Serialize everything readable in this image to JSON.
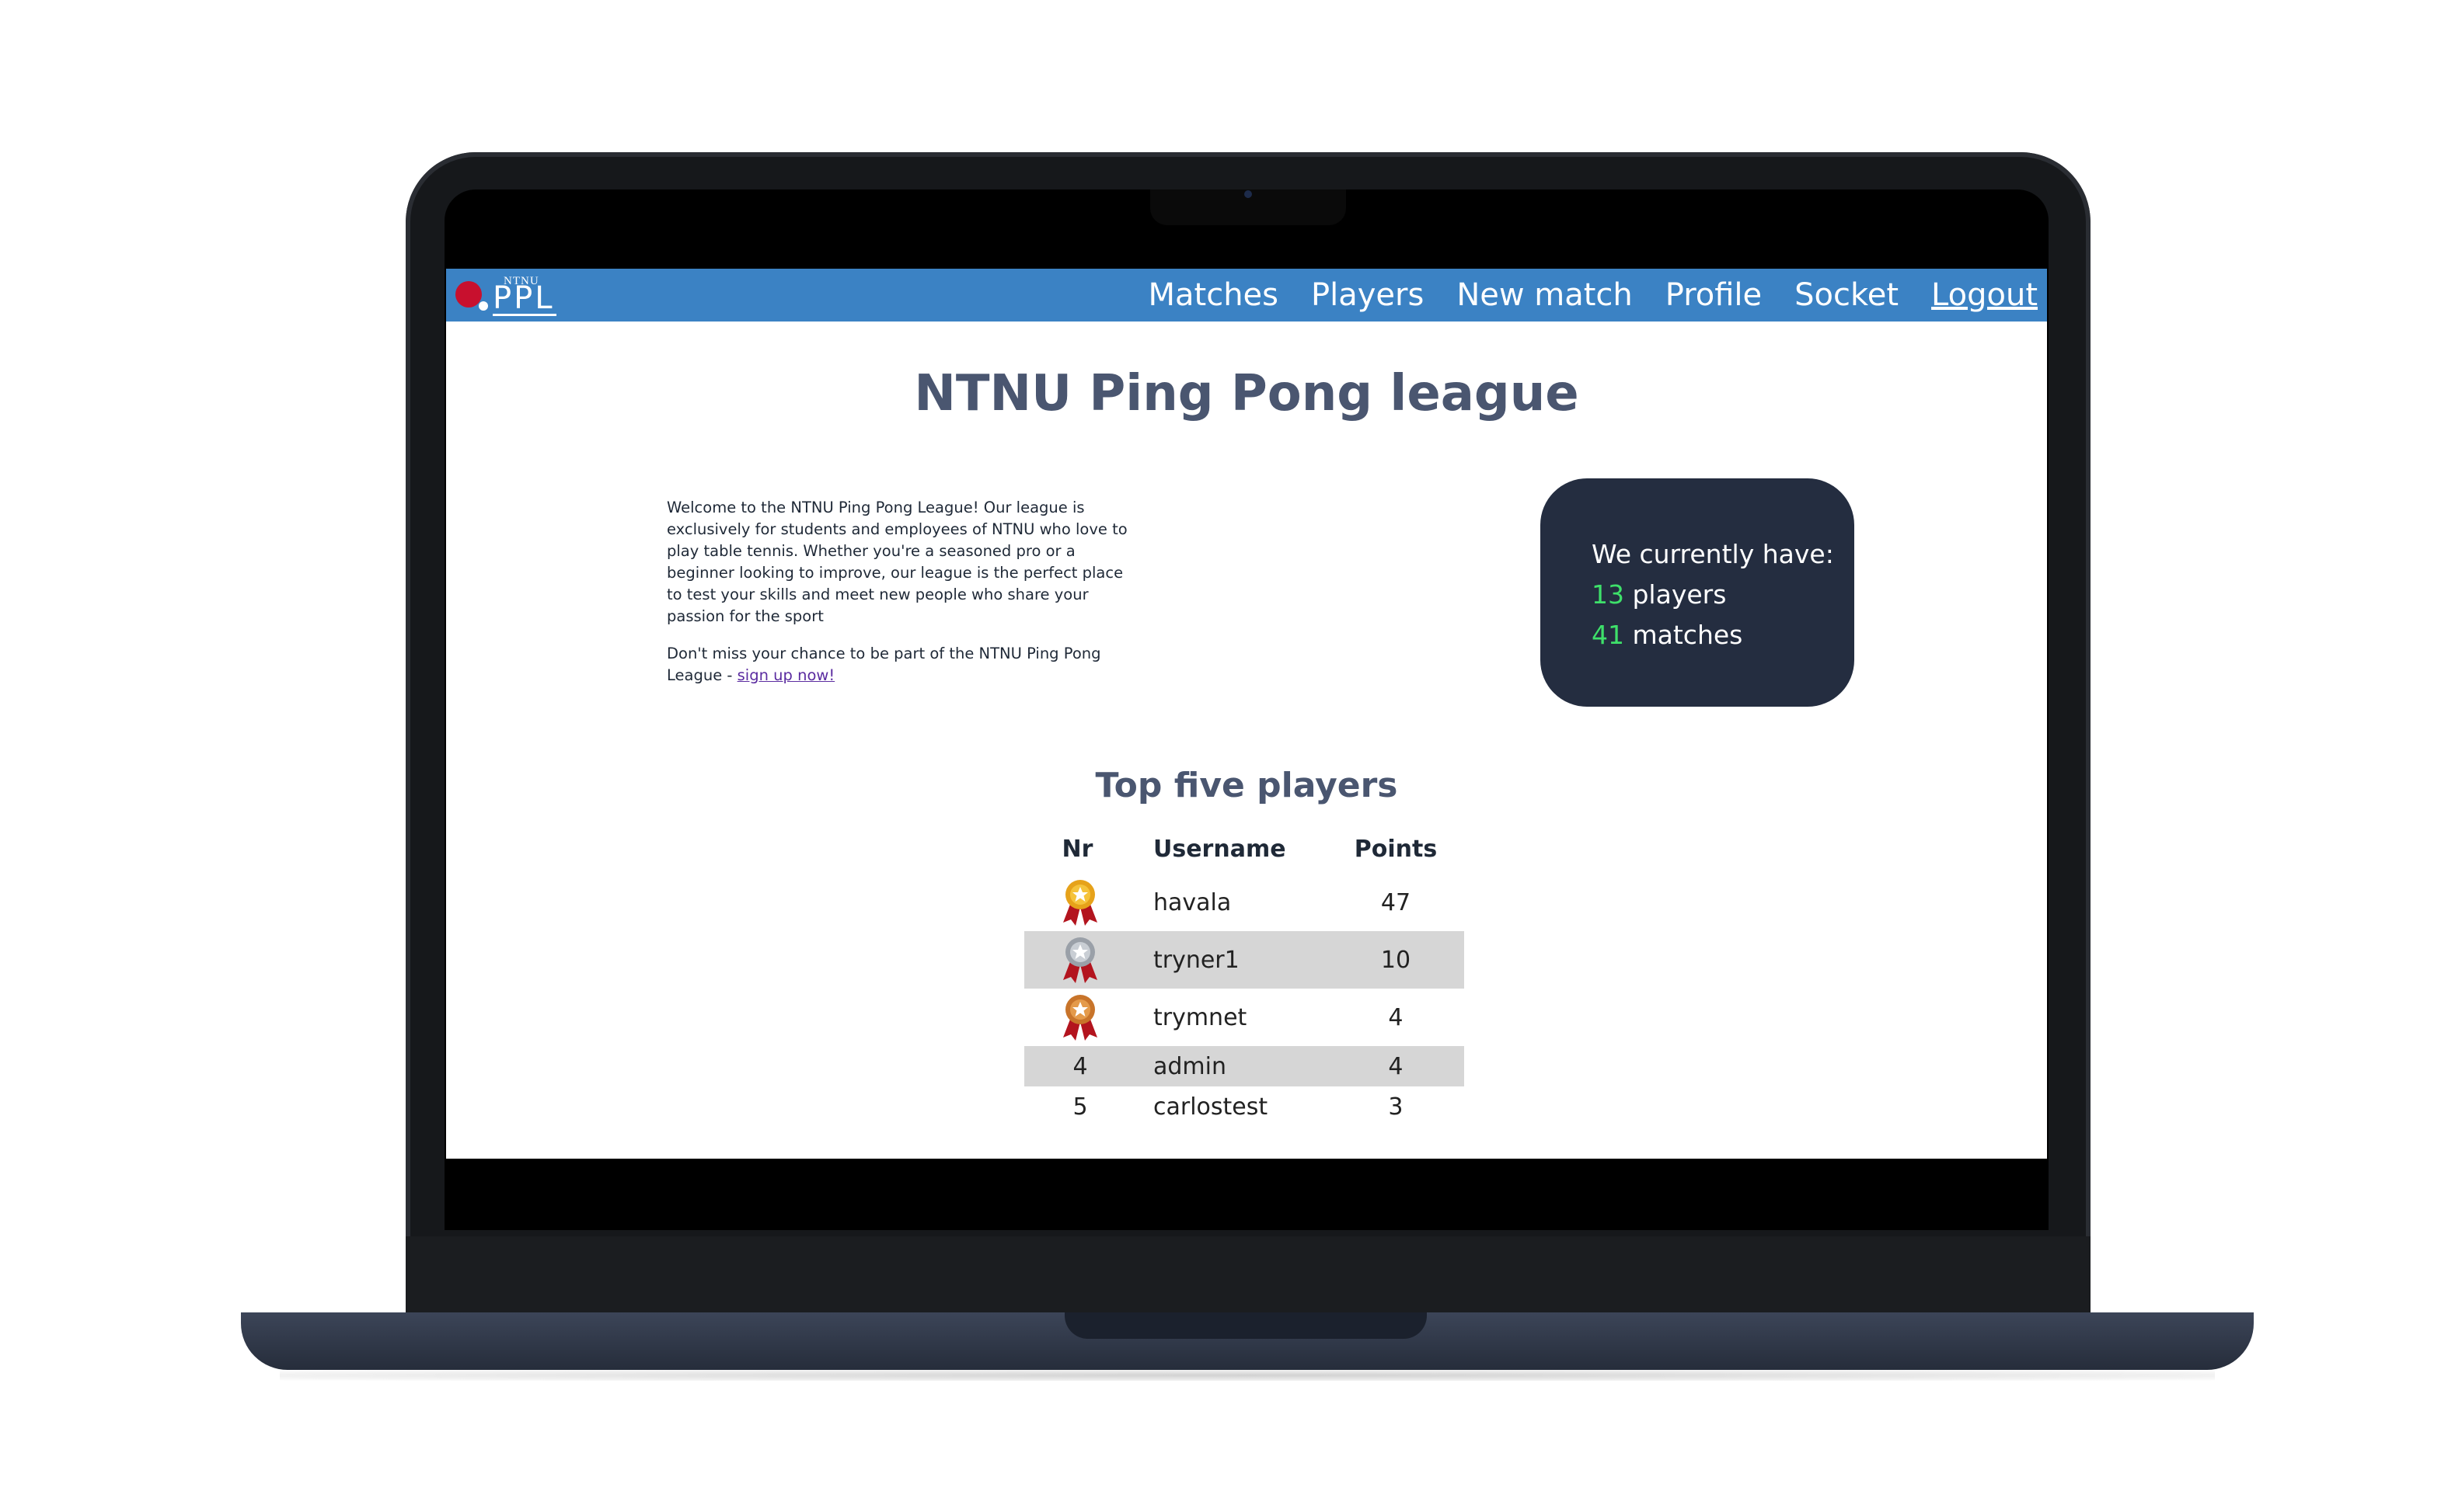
{
  "nav": {
    "logo_small": "NTNU",
    "logo_big": "PPL",
    "links": [
      "Matches",
      "Players",
      "New match",
      "Profile",
      "Socket",
      "Logout"
    ]
  },
  "main": {
    "title": "NTNU Ping Pong league",
    "intro_p1": "Welcome to the NTNU Ping Pong League! Our league is exclusively for students and employees of NTNU who love to play table tennis. Whether you're a seasoned pro or a beginner looking to improve, our league is the perfect place to test your skills and meet new people who share your passion for the sport",
    "intro_p2_text": "Don't miss your chance to be part of the NTNU Ping Pong League - ",
    "intro_p2_link": "sign up now!"
  },
  "stats": {
    "heading": "We currently have:",
    "players_count": "13",
    "players_label": " players",
    "matches_count": "41",
    "matches_label": " matches"
  },
  "leaderboard": {
    "title": "Top five players",
    "headers": [
      "Nr",
      "Username",
      "Points"
    ],
    "rows": [
      {
        "nr": "",
        "medal": "gold-medal-icon",
        "username": "havala",
        "points": "47"
      },
      {
        "nr": "",
        "medal": "silver-medal-icon",
        "username": "tryner1",
        "points": "10"
      },
      {
        "nr": "",
        "medal": "bronze-medal-icon",
        "username": "trymnet",
        "points": "4"
      },
      {
        "nr": "4",
        "medal": "",
        "username": "admin",
        "points": "4"
      },
      {
        "nr": "5",
        "medal": "",
        "username": "carlostest",
        "points": "3"
      }
    ]
  },
  "colors": {
    "navbar": "#3b82c4",
    "stats_card": "#242d40",
    "stat_number": "#3ee06a",
    "heading": "#4a5670",
    "stripe": "#d6d6d6"
  }
}
